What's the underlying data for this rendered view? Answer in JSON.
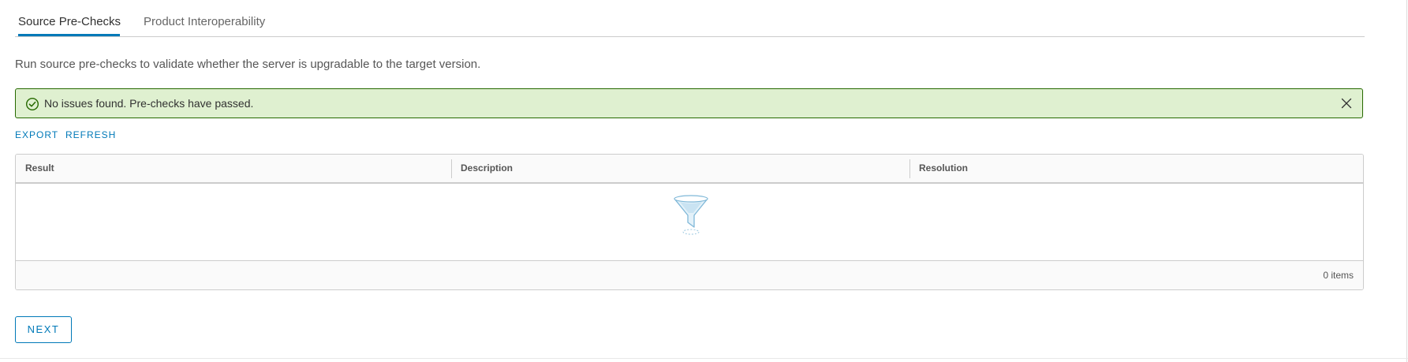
{
  "tabs": [
    {
      "label": "Source Pre-Checks",
      "active": true
    },
    {
      "label": "Product Interoperability",
      "active": false
    }
  ],
  "intro_text": "Run source pre-checks to validate whether the server is upgradable to the target version.",
  "alert": {
    "type": "success",
    "icon": "check-circle-icon",
    "message": "No issues found. Pre-checks have passed.",
    "close_icon": "close-icon"
  },
  "actions": {
    "export_label": "EXPORT",
    "refresh_label": "REFRESH"
  },
  "grid": {
    "columns": [
      "Result",
      "Description",
      "Resolution"
    ],
    "rows": [],
    "empty_icon": "filter-funnel-icon",
    "footer_count": "0 items"
  },
  "next_button": {
    "label": "NEXT"
  },
  "colors": {
    "accent": "#0079b8",
    "success_bg": "#dff0d0",
    "success_border": "#266900"
  }
}
